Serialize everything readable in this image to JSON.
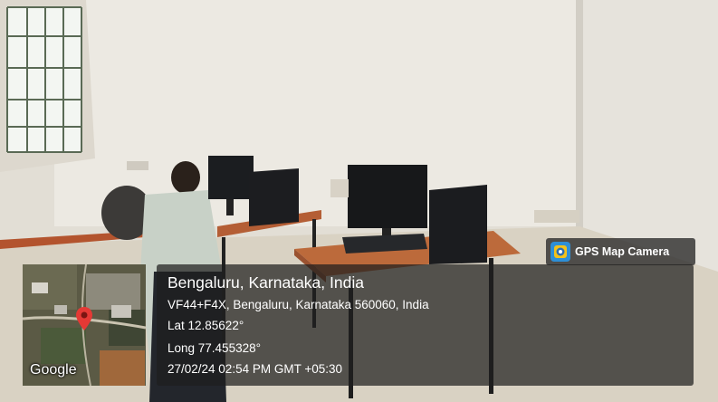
{
  "overlay": {
    "app_badge": {
      "label": "GPS Map Camera",
      "icon": "gps-map-camera-logo-icon"
    },
    "map": {
      "provider_label": "Google",
      "icon": "map-pin-icon"
    },
    "location": {
      "city_line": "Bengaluru, Karnataka, India",
      "address_line": "VF44+F4X, Bengaluru, Karnataka 560060, India",
      "latitude_line": "Lat 12.85622°",
      "longitude_line": "Long 77.455328°",
      "datetime_line": "27/02/24 02:54 PM GMT +05:30"
    }
  },
  "colors": {
    "overlay_bg": "#1e1e1e",
    "pin": "#e53935",
    "badge_logo": "#2e8fd6"
  }
}
